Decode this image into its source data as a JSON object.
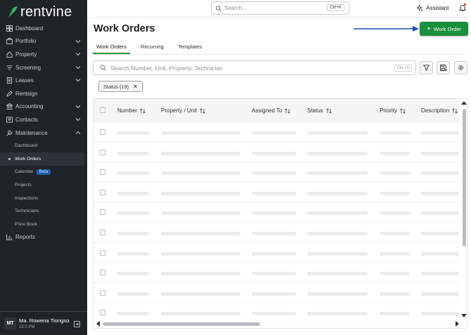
{
  "brand": {
    "name": "rentvine",
    "accent": "#1a8f3c"
  },
  "sidebar": {
    "items": [
      {
        "label": "Dashboard",
        "icon": "dashboard-icon",
        "chevron": false
      },
      {
        "label": "Portfolio",
        "icon": "portfolio-icon",
        "chevron": true
      },
      {
        "label": "Property",
        "icon": "home-icon",
        "chevron": true
      },
      {
        "label": "Screening",
        "icon": "filter-lines-icon",
        "chevron": true
      },
      {
        "label": "Leases",
        "icon": "lease-icon",
        "chevron": true
      },
      {
        "label": "Rentsign",
        "icon": "pen-icon",
        "chevron": false
      },
      {
        "label": "Accounting",
        "icon": "bank-icon",
        "chevron": true
      },
      {
        "label": "Contacts",
        "icon": "contacts-icon",
        "chevron": true
      },
      {
        "label": "Maintenance",
        "icon": "wrench-icon",
        "chevron": true
      }
    ],
    "maintenance_sub": [
      {
        "label": "Dashboard"
      },
      {
        "label": "Work Orders",
        "active": true
      },
      {
        "label": "Calendar",
        "badge": "Beta"
      },
      {
        "label": "Projects"
      },
      {
        "label": "Inspections"
      },
      {
        "label": "Technicians"
      },
      {
        "label": "Price Book"
      }
    ],
    "reports": {
      "label": "Reports",
      "icon": "chart-icon"
    },
    "user": {
      "initials": "MT",
      "name": "Ma. Rowena Tiongson",
      "time": "12:3 PM"
    }
  },
  "topbar": {
    "search_placeholder": "Search...",
    "search_shortcut": "Ctrl+K",
    "assistant_label": "Assistant"
  },
  "main": {
    "title": "Work Orders",
    "new_button": "Work Order",
    "tabs": [
      {
        "label": "Work Orders",
        "active": true
      },
      {
        "label": "Recurring"
      },
      {
        "label": "Templates"
      }
    ],
    "search_placeholder": "Search Number, Unit, Property, Technician",
    "search_shortcut": "Ctrl +S",
    "filter_chip": "Status (19)",
    "columns": [
      "Number",
      "Property / Unit",
      "Assigned To",
      "Status",
      "Priority",
      "Description"
    ]
  }
}
